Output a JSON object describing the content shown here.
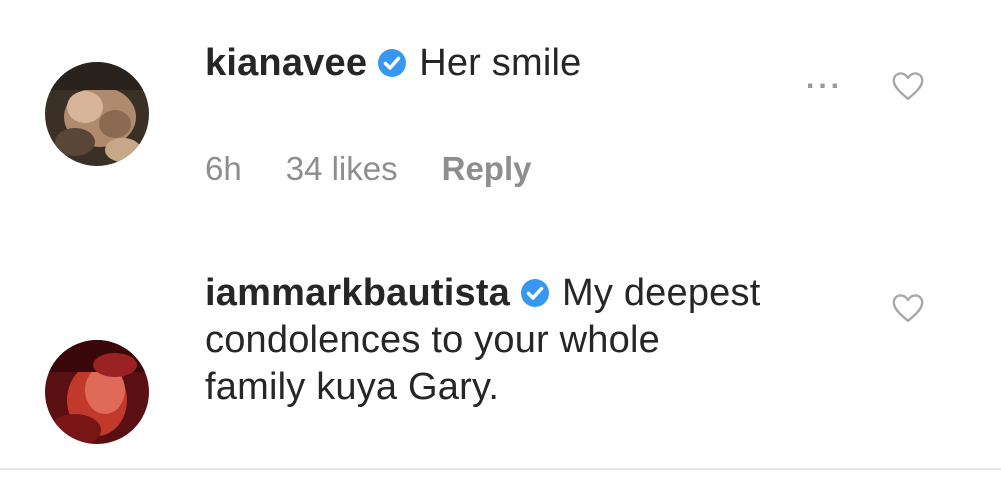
{
  "comments": [
    {
      "username": "kianavee",
      "verified": true,
      "text": "Her smile",
      "time": "6h",
      "likes": "34 likes",
      "reply_label": "Reply",
      "more_label": "...",
      "avatar_icon": "user-avatar-icon",
      "heart_icon": "heart-outline-icon"
    },
    {
      "username": "iammarkbautista",
      "verified": true,
      "text_lines": [
        "My deepest",
        "condolences to your whole",
        "family kuya Gary."
      ],
      "avatar_icon": "user-avatar-icon",
      "heart_icon": "heart-outline-icon"
    }
  ],
  "colors": {
    "text": "#262626",
    "meta": "#8e8e8e",
    "verified": "#3897f0"
  }
}
